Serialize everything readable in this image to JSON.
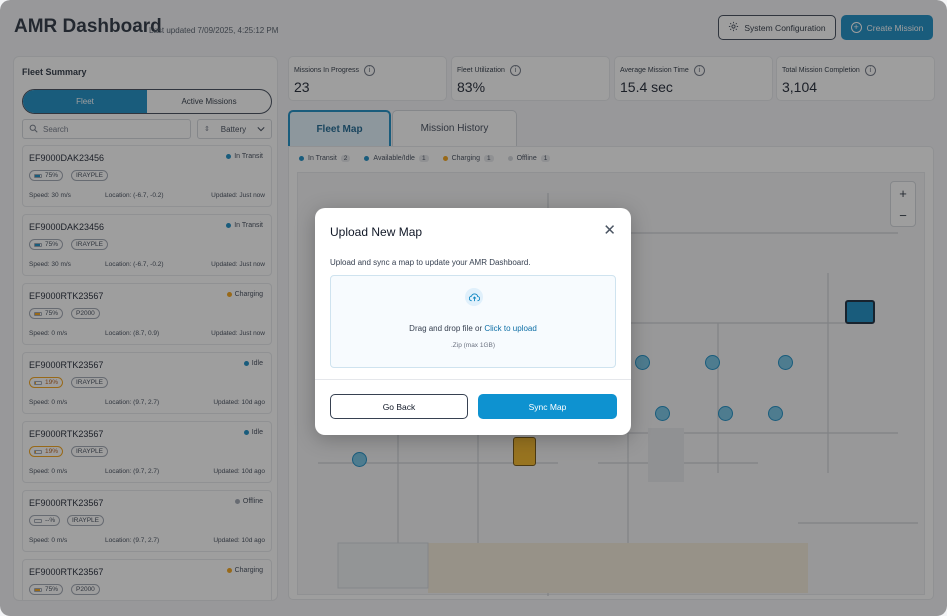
{
  "header": {
    "title": "AMR Dashboard",
    "last_updated": "Last updated 7/09/2025, 4:25:12 PM",
    "config_label": "System Configuration",
    "create_label": "Create Mission"
  },
  "fleet": {
    "title": "Fleet Summary",
    "segments": [
      "Fleet",
      "Active Missions"
    ],
    "search_placeholder": "Search",
    "sort_label": "Battery",
    "cards": [
      {
        "id": "EF9000DAK23456",
        "status": "In Transit",
        "status_color": "#0e87c2",
        "battery": "75%",
        "battery_fill": 0.75,
        "battery_color": "#0e87c2",
        "model": "IRAYPLE",
        "speed": "Speed: 30 m/s",
        "location": "Location: (-6.7, -0.2)",
        "updated": "Updated: Just now"
      },
      {
        "id": "EF9000DAK23456",
        "status": "In Transit",
        "status_color": "#0e87c2",
        "battery": "75%",
        "battery_fill": 0.75,
        "battery_color": "#0e87c2",
        "model": "IRAYPLE",
        "speed": "Speed: 30 m/s",
        "location": "Location: (-6.7, -0.2)",
        "updated": "Updated: Just now"
      },
      {
        "id": "EF9000RTK23567",
        "status": "Charging",
        "status_color": "#f59e0b",
        "battery": "75%",
        "battery_fill": 0.75,
        "battery_color": "#f59e0b",
        "model": "P2000",
        "speed": "Speed: 0 m/s",
        "location": "Location: (8.7, 0.9)",
        "updated": "Updated: Just now"
      },
      {
        "id": "EF9000RTK23567",
        "status": "Idle",
        "status_color": "#0e87c2",
        "battery": "19%",
        "battery_fill": 0.19,
        "battery_color": "#f59e0b",
        "model": "IRAYPLE",
        "speed": "Speed: 0 m/s",
        "location": "Location: (9.7, 2.7)",
        "updated": "Updated: 10d ago"
      },
      {
        "id": "EF9000RTK23567",
        "status": "Idle",
        "status_color": "#0e87c2",
        "battery": "19%",
        "battery_fill": 0.19,
        "battery_color": "#f59e0b",
        "model": "IRAYPLE",
        "speed": "Speed: 0 m/s",
        "location": "Location: (9.7, 2.7)",
        "updated": "Updated: 10d ago"
      },
      {
        "id": "EF9000RTK23567",
        "status": "Offline",
        "status_color": "#9ca3af",
        "battery": "--%",
        "battery_fill": 0.0,
        "battery_color": "#9ca3af",
        "model": "IRAYPLE",
        "speed": "Speed: 0 m/s",
        "location": "Location: (9.7, 2.7)",
        "updated": "Updated: 10d ago"
      },
      {
        "id": "EF9000RTK23567",
        "status": "Charging",
        "status_color": "#f59e0b",
        "battery": "75%",
        "battery_fill": 0.75,
        "battery_color": "#f59e0b",
        "model": "P2000",
        "speed": "",
        "location": "",
        "updated": ""
      }
    ]
  },
  "kpis": [
    {
      "label": "Missions In Progress",
      "value": "23"
    },
    {
      "label": "Fleet Utilization",
      "value": "83%"
    },
    {
      "label": "Average Mission Time",
      "value": "15.4 sec"
    },
    {
      "label": "Total Mission Completion",
      "value": "3,104"
    }
  ],
  "map": {
    "tabs": [
      "Fleet Map",
      "Mission History"
    ],
    "legend": [
      {
        "label": "In Transit",
        "count": "2",
        "color": "#0e87c2"
      },
      {
        "label": "Available/Idle",
        "count": "1",
        "color": "#0e87c2"
      },
      {
        "label": "Charging",
        "count": "1",
        "color": "#f59e0b"
      },
      {
        "label": "Offline",
        "count": "1",
        "color": "#d1d5db"
      }
    ],
    "zoom_in": "+",
    "zoom_out": "−"
  },
  "modal": {
    "title": "Upload New Map",
    "close": "✕",
    "description": "Upload and sync a map to update your AMR Dashboard.",
    "drop_text": "Drag and drop file or",
    "drop_link": "Click to upload",
    "hint": ".Zip (max 1GB)",
    "back_label": "Go Back",
    "sync_label": "Sync Map"
  }
}
